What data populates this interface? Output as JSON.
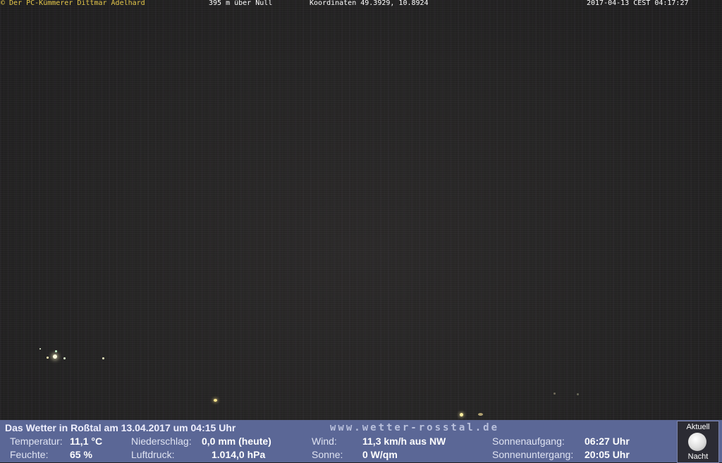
{
  "overlay": {
    "owner": "© Der PC-Kümmerer Dittmar Adelhard",
    "altitude": "395 m über Null",
    "coordinates": "Koordinaten 49.3929, 10.8924",
    "timestamp": "2017-04-13 CEST 04:17:27"
  },
  "weather": {
    "headline": "Das Wetter in Roßtal am 13.04.2017 um 04:15 Uhr",
    "website": "www.wetter-rosstal.de",
    "temperature_label": "Temperatur:",
    "temperature_value": "11,1 °C",
    "humidity_label": "Feuchte:",
    "humidity_value": "65 %",
    "precip_label": "Niederschlag:",
    "precip_value": "0,0 mm (heute)",
    "pressure_label": "Luftdruck:",
    "pressure_value": "1.014,0 hPa",
    "wind_label": "Wind:",
    "wind_value": "11,3 km/h aus NW",
    "sun_label": "Sonne:",
    "sun_value": "0 W/qm",
    "sunrise_label": "Sonnenaufgang:",
    "sunrise_value": "06:27 Uhr",
    "sunset_label": "Sonnenuntergang:",
    "sunset_value": "20:05 Uhr"
  },
  "moon": {
    "top_label": "Aktuell",
    "bottom_label": "Nacht",
    "icon": "full-moon-icon"
  },
  "colors": {
    "panel_background": "#5b6796",
    "owner_text": "#e6c84a"
  }
}
